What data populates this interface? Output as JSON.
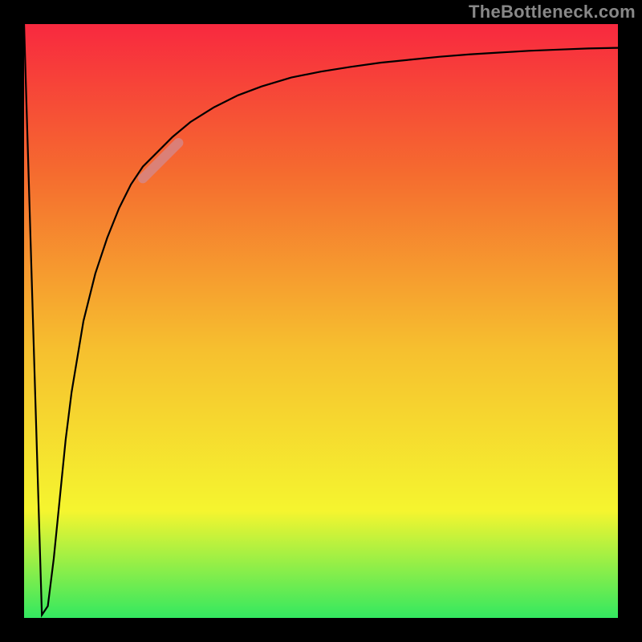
{
  "watermark": "TheBottleneck.com",
  "chart_data": {
    "type": "line",
    "title": "",
    "xlabel": "",
    "ylabel": "",
    "xlim": [
      0,
      100
    ],
    "ylim": [
      0,
      100
    ],
    "x": [
      0,
      1.5,
      3,
      4,
      5,
      6,
      7,
      8,
      10,
      12,
      14,
      16,
      18,
      20,
      22,
      25,
      28,
      32,
      36,
      40,
      45,
      50,
      55,
      60,
      65,
      70,
      75,
      80,
      85,
      90,
      95,
      100
    ],
    "values": [
      100,
      50,
      0.5,
      2,
      10,
      20,
      30,
      38,
      50,
      58,
      64,
      69,
      73,
      76,
      78,
      81,
      83.5,
      86,
      88,
      89.5,
      91,
      92,
      92.8,
      93.5,
      94,
      94.5,
      94.9,
      95.2,
      95.5,
      95.7,
      95.9,
      96
    ],
    "highlight": {
      "x_start": 20,
      "x_end": 26,
      "y_start": 74,
      "y_end": 80
    },
    "background_gradient": {
      "top": "#f8293f",
      "upper_mid": "#f56b2f",
      "mid": "#f6c02f",
      "lower_mid": "#f5f52f",
      "bottom": "#33e860"
    }
  }
}
